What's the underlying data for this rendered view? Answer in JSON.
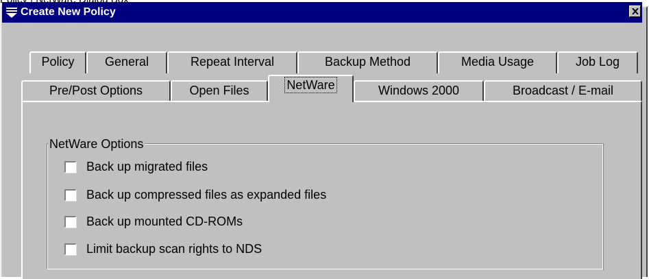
{
  "caption": "Policy | NetWare Dialog Box",
  "window": {
    "title": "Create New Policy",
    "title_icon": "dropdown-funnel-icon",
    "close_icon": "close-icon"
  },
  "tabs": {
    "back_row": [
      "Policy",
      "General",
      "Repeat Interval",
      "Backup Method",
      "Media Usage",
      "Job Log"
    ],
    "front_row": [
      "Pre/Post Options",
      "Open Files",
      "NetWare",
      "Windows 2000",
      "Broadcast / E-mail"
    ],
    "active": "NetWare"
  },
  "netware_options": {
    "group_label": "NetWare Options",
    "options": [
      {
        "label": "Back up migrated files",
        "checked": false
      },
      {
        "label": "Back up compressed files as expanded files",
        "checked": false
      },
      {
        "label": "Back up mounted CD-ROMs",
        "checked": false
      },
      {
        "label": "Limit backup scan rights to NDS",
        "checked": false
      }
    ]
  },
  "colors": {
    "titlebar": "#000080",
    "face": "#c0c0c0"
  }
}
